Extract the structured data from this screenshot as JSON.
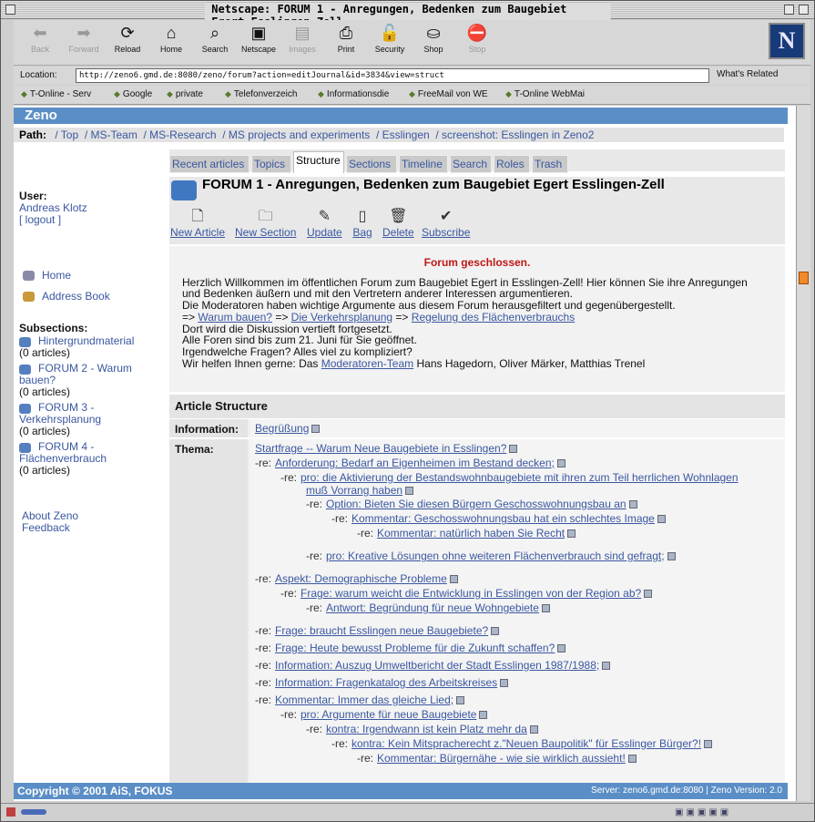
{
  "window": {
    "title": "Netscape: FORUM 1 - Anregungen, Bedenken zum Baugebiet Egert Esslingen-Zell"
  },
  "toolbar": {
    "back": "Back",
    "forward": "Forward",
    "reload": "Reload",
    "home": "Home",
    "search": "Search",
    "netscape": "Netscape",
    "images": "Images",
    "print": "Print",
    "security": "Security",
    "shop": "Shop",
    "stop": "Stop",
    "logo": "N"
  },
  "location": {
    "label": "Location:",
    "url": "http://zeno6.gmd.de:8080/zeno/forum?action=editJournal&id=3834&view=struct",
    "whats_related": "What's Related"
  },
  "bookmarks": [
    "T-Online - Serv",
    "Google",
    "private",
    "Telefonverzeich",
    "Informationsdie",
    "FreeMail von WE",
    "T-Online WebMai"
  ],
  "zeno": {
    "brand": "Zeno"
  },
  "path": {
    "label": "Path:",
    "items": [
      "/ Top",
      "/ MS-Team",
      "/ MS-Research",
      "/ MS projects and experiments",
      "/ Esslingen",
      "/ screenshot: Esslingen in Zeno2"
    ]
  },
  "sidebar": {
    "user_label": "User:",
    "user_name": "Andreas Klotz",
    "logout": "[ logout ]",
    "home": "Home",
    "address_book": "Address Book",
    "subsections_label": "Subsections:",
    "subsections": [
      {
        "line1": "Hintergrundmaterial",
        "line2": "",
        "count": "(0 articles)"
      },
      {
        "line1": "FORUM 2 - Warum",
        "line2": "bauen?",
        "count": "(0 articles)"
      },
      {
        "line1": "FORUM 3 -",
        "line2": "Verkehrsplanung",
        "count": "(0 articles)"
      },
      {
        "line1": "FORUM 4 -",
        "line2": "Flächenverbrauch",
        "count": "(0 articles)"
      }
    ],
    "about": "About Zeno",
    "feedback": "Feedback"
  },
  "tabs": [
    "Recent articles",
    "Topics",
    "Structure",
    "Sections",
    "Timeline",
    "Search",
    "Roles",
    "Trash"
  ],
  "forum_title": "FORUM 1 - Anregungen, Bedenken zum Baugebiet Egert Esslingen-Zell",
  "actions": [
    "New Article",
    "New Section",
    "Update",
    "Bag",
    "Delete",
    "Subscribe"
  ],
  "intro": {
    "closed": "Forum geschlossen",
    "l1": "Herzlich Willkommen im öffentlichen Forum zum Baugebiet Egert in Esslingen-Zell! Hier können Sie ihre Anregungen",
    "l2": "und Bedenken äußern und mit den Vertretern anderer Interessen argumentieren.",
    "l3": "Die Moderatoren haben wichtige Argumente aus diesem Forum herausgefiltert und gegenübergestellt.",
    "arrow": "=>",
    "link1": "Warum bauen?",
    "link2": "Die Verkehrsplanung",
    "link3": "Regelung des Flächenverbrauchs",
    "l5": "Dort wird die Diskussion vertieft fortgesetzt.",
    "l6": "Alle Foren sind bis zum 21. Juni für Sie geöffnet.",
    "l7": "Irgendwelche Fragen? Alles viel zu kompliziert?",
    "l8a": "Wir helfen Ihnen gerne: Das",
    "l8link": "Moderatoren-Team",
    "l8b": "Hans Hagedorn, Oliver Märker, Matthias Trenel"
  },
  "structure": {
    "heading": "Article Structure",
    "info_label": "Information:",
    "info_link": "Begrüßung",
    "thema_label": "Thema:",
    "re": "-re:",
    "threads": [
      "Startfrage -- Warum Neue Baugebiete in Esslingen?",
      "Anforderung: Bedarf an Eigenheimen im Bestand decken;",
      "pro: die Aktivierung der Bestandswohnbaugebiete mit ihren zum Teil herrlichen Wohnlagen",
      "muß Vorrang haben",
      "Option: Bieten Sie diesen Bürgern Geschosswohnungsbau an",
      "Kommentar: Geschosswohnungsbau hat ein schlechtes Image",
      "Kommentar: natürlich haben Sie Recht",
      "pro: Kreative Lösungen ohne weiteren Flächenverbrauch sind gefragt;",
      "Aspekt: Demographische Probleme",
      "Frage: warum weicht die Entwicklung in Esslingen von der Region ab?",
      "Antwort: Begründung für neue Wohngebiete",
      "Frage: braucht Esslingen neue Baugebiete?",
      "Frage: Heute bewusst Probleme für die Zukunft schaffen?",
      "Information: Auszug Umweltbericht der Stadt Esslingen 1987/1988;",
      "Information: Fragenkatalog des Arbeitskreises",
      "Kommentar: Immer das gleiche Lied;",
      "pro: Argumente für neue Baugebiete",
      "kontra: Irgendwann ist kein Platz mehr da",
      "kontra: Kein Mitspracherecht z.\"Neuen Baupolitik\" für Esslinger Bürger?!",
      "Kommentar: Bürgernähe - wie sie wirklich aussieht!"
    ]
  },
  "footer": {
    "copyright": "Copyright © 2001 AiS, FOKUS",
    "server": "Server: zeno6.gmd.de:8080 | Zeno Version: 2.0"
  }
}
